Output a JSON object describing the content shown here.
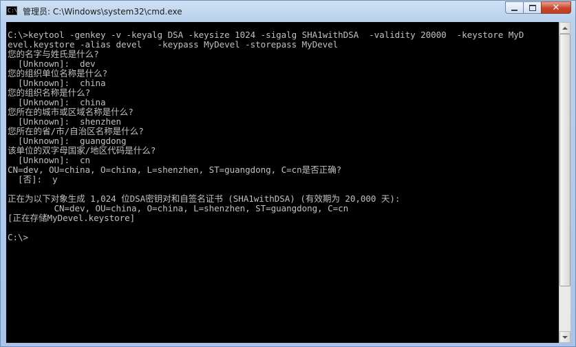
{
  "window": {
    "title": "管理员: C:\\Windows\\system32\\cmd.exe",
    "icon_label": "C:\\"
  },
  "caption": {
    "minimize": "minimize",
    "maximize": "maximize",
    "close": "close"
  },
  "console": {
    "lines": [
      "C:\\>keytool -genkey -v -keyalg DSA -keysize 1024 -sigalg SHA1withDSA  -validity 20000  -keystore MyD",
      "evel.keystore -alias devel   -keypass MyDevel -storepass MyDevel",
      "您的名字与姓氏是什么?",
      "  [Unknown]:  dev",
      "您的组织单位名称是什么?",
      "  [Unknown]:  china",
      "您的组织名称是什么?",
      "  [Unknown]:  china",
      "您所在的城市或区域名称是什么?",
      "  [Unknown]:  shenzhen",
      "您所在的省/市/自治区名称是什么?",
      "  [Unknown]:  guangdong",
      "该单位的双字母国家/地区代码是什么?",
      "  [Unknown]:  cn",
      "CN=dev, OU=china, O=china, L=shenzhen, ST=guangdong, C=cn是否正确?",
      "  [否]:  y",
      "",
      "正在为以下对象生成 1,024 位DSA密钥对和自签名证书 (SHA1withDSA) (有效期为 20,000 天):",
      "         CN=dev, OU=china, O=china, L=shenzhen, ST=guangdong, C=cn",
      "[正在存储MyDevel.keystore]",
      "",
      "C:\\>"
    ]
  },
  "scrollbar": {
    "position": 0.0,
    "visible_fraction": 0.85
  }
}
